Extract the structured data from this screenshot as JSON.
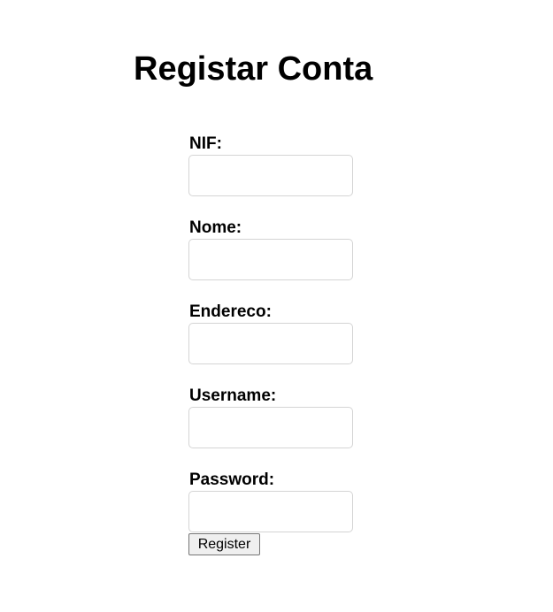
{
  "page": {
    "title": "Registar Conta"
  },
  "form": {
    "fields": [
      {
        "label": "NIF:",
        "value": ""
      },
      {
        "label": "Nome:",
        "value": ""
      },
      {
        "label": "Endereco:",
        "value": ""
      },
      {
        "label": "Username:",
        "value": ""
      },
      {
        "label": "Password:",
        "value": ""
      }
    ],
    "submit_label": "Register"
  },
  "colors": {
    "background": "#ffffff",
    "text": "#000000",
    "input_border": "#d4d4d4",
    "button_background": "#efefef",
    "button_border": "#767676"
  }
}
